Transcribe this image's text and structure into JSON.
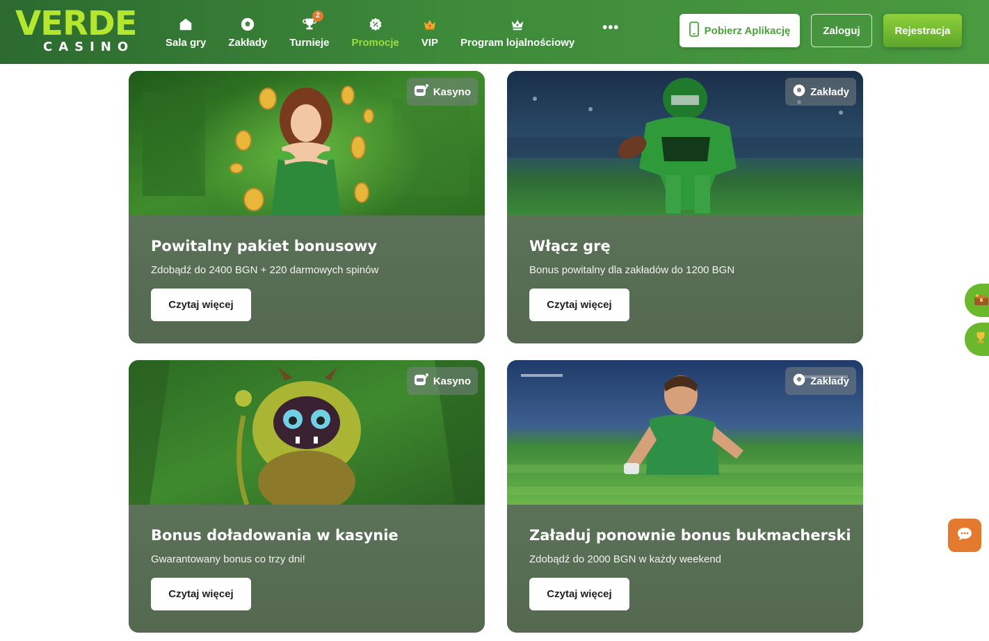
{
  "header": {
    "logo": {
      "brand": "VERDE",
      "sub": "CASINO"
    },
    "nav": [
      {
        "label": "Sala gry",
        "icon": "home-icon",
        "active": false
      },
      {
        "label": "Zakłady",
        "icon": "soccer-ball-icon",
        "active": false
      },
      {
        "label": "Turnieje",
        "icon": "trophy-icon",
        "active": false,
        "badge": "2"
      },
      {
        "label": "Promocje",
        "icon": "percent-badge-icon",
        "active": true
      },
      {
        "label": "VIP",
        "icon": "crown-icon",
        "active": false
      },
      {
        "label": "Program lojalnościowy",
        "icon": "crown-outline-icon",
        "active": false
      }
    ],
    "more": "•••",
    "app_button": "Pobierz Aplikację",
    "login_button": "Zaloguj",
    "register_button": "Rejestracja"
  },
  "promotions": [
    {
      "tag": "Kasyno",
      "title": "Powitalny pakiet bonusowy",
      "subtitle": "Zdobądź do 2400 BGN + 220 darmowych spinów",
      "cta": "Czytaj więcej"
    },
    {
      "tag": "Zakłady",
      "title": "Włącz grę",
      "subtitle": "Bonus powitalny dla zakładów do 1200 BGN",
      "cta": "Czytaj więcej"
    },
    {
      "tag": "Kasyno",
      "title": "Bonus doładowania w kasynie",
      "subtitle": "Gwarantowany bonus co trzy dni!",
      "cta": "Czytaj więcej"
    },
    {
      "tag": "Zakłady",
      "title": "Załaduj ponownie bonus bukmacherski",
      "subtitle": "Zdobądź do 2000 BGN w każdy weekend",
      "cta": "Czytaj więcej"
    }
  ],
  "colors": {
    "header_green": "#3d8a3a",
    "accent_lime": "#b5e62e",
    "active_nav": "#9edd3d",
    "register_green": "#6cb82e",
    "chat_orange": "#e47a2e"
  }
}
